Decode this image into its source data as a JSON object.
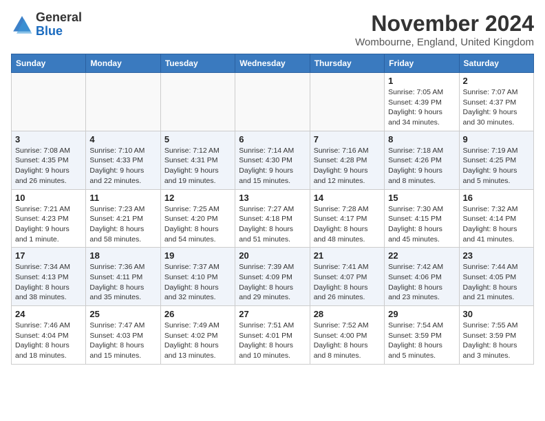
{
  "logo": {
    "general": "General",
    "blue": "Blue"
  },
  "title": "November 2024",
  "location": "Wombourne, England, United Kingdom",
  "weekdays": [
    "Sunday",
    "Monday",
    "Tuesday",
    "Wednesday",
    "Thursday",
    "Friday",
    "Saturday"
  ],
  "weeks": [
    [
      {
        "day": "",
        "info": ""
      },
      {
        "day": "",
        "info": ""
      },
      {
        "day": "",
        "info": ""
      },
      {
        "day": "",
        "info": ""
      },
      {
        "day": "",
        "info": ""
      },
      {
        "day": "1",
        "info": "Sunrise: 7:05 AM\nSunset: 4:39 PM\nDaylight: 9 hours\nand 34 minutes."
      },
      {
        "day": "2",
        "info": "Sunrise: 7:07 AM\nSunset: 4:37 PM\nDaylight: 9 hours\nand 30 minutes."
      }
    ],
    [
      {
        "day": "3",
        "info": "Sunrise: 7:08 AM\nSunset: 4:35 PM\nDaylight: 9 hours\nand 26 minutes."
      },
      {
        "day": "4",
        "info": "Sunrise: 7:10 AM\nSunset: 4:33 PM\nDaylight: 9 hours\nand 22 minutes."
      },
      {
        "day": "5",
        "info": "Sunrise: 7:12 AM\nSunset: 4:31 PM\nDaylight: 9 hours\nand 19 minutes."
      },
      {
        "day": "6",
        "info": "Sunrise: 7:14 AM\nSunset: 4:30 PM\nDaylight: 9 hours\nand 15 minutes."
      },
      {
        "day": "7",
        "info": "Sunrise: 7:16 AM\nSunset: 4:28 PM\nDaylight: 9 hours\nand 12 minutes."
      },
      {
        "day": "8",
        "info": "Sunrise: 7:18 AM\nSunset: 4:26 PM\nDaylight: 9 hours\nand 8 minutes."
      },
      {
        "day": "9",
        "info": "Sunrise: 7:19 AM\nSunset: 4:25 PM\nDaylight: 9 hours\nand 5 minutes."
      }
    ],
    [
      {
        "day": "10",
        "info": "Sunrise: 7:21 AM\nSunset: 4:23 PM\nDaylight: 9 hours\nand 1 minute."
      },
      {
        "day": "11",
        "info": "Sunrise: 7:23 AM\nSunset: 4:21 PM\nDaylight: 8 hours\nand 58 minutes."
      },
      {
        "day": "12",
        "info": "Sunrise: 7:25 AM\nSunset: 4:20 PM\nDaylight: 8 hours\nand 54 minutes."
      },
      {
        "day": "13",
        "info": "Sunrise: 7:27 AM\nSunset: 4:18 PM\nDaylight: 8 hours\nand 51 minutes."
      },
      {
        "day": "14",
        "info": "Sunrise: 7:28 AM\nSunset: 4:17 PM\nDaylight: 8 hours\nand 48 minutes."
      },
      {
        "day": "15",
        "info": "Sunrise: 7:30 AM\nSunset: 4:15 PM\nDaylight: 8 hours\nand 45 minutes."
      },
      {
        "day": "16",
        "info": "Sunrise: 7:32 AM\nSunset: 4:14 PM\nDaylight: 8 hours\nand 41 minutes."
      }
    ],
    [
      {
        "day": "17",
        "info": "Sunrise: 7:34 AM\nSunset: 4:13 PM\nDaylight: 8 hours\nand 38 minutes."
      },
      {
        "day": "18",
        "info": "Sunrise: 7:36 AM\nSunset: 4:11 PM\nDaylight: 8 hours\nand 35 minutes."
      },
      {
        "day": "19",
        "info": "Sunrise: 7:37 AM\nSunset: 4:10 PM\nDaylight: 8 hours\nand 32 minutes."
      },
      {
        "day": "20",
        "info": "Sunrise: 7:39 AM\nSunset: 4:09 PM\nDaylight: 8 hours\nand 29 minutes."
      },
      {
        "day": "21",
        "info": "Sunrise: 7:41 AM\nSunset: 4:07 PM\nDaylight: 8 hours\nand 26 minutes."
      },
      {
        "day": "22",
        "info": "Sunrise: 7:42 AM\nSunset: 4:06 PM\nDaylight: 8 hours\nand 23 minutes."
      },
      {
        "day": "23",
        "info": "Sunrise: 7:44 AM\nSunset: 4:05 PM\nDaylight: 8 hours\nand 21 minutes."
      }
    ],
    [
      {
        "day": "24",
        "info": "Sunrise: 7:46 AM\nSunset: 4:04 PM\nDaylight: 8 hours\nand 18 minutes."
      },
      {
        "day": "25",
        "info": "Sunrise: 7:47 AM\nSunset: 4:03 PM\nDaylight: 8 hours\nand 15 minutes."
      },
      {
        "day": "26",
        "info": "Sunrise: 7:49 AM\nSunset: 4:02 PM\nDaylight: 8 hours\nand 13 minutes."
      },
      {
        "day": "27",
        "info": "Sunrise: 7:51 AM\nSunset: 4:01 PM\nDaylight: 8 hours\nand 10 minutes."
      },
      {
        "day": "28",
        "info": "Sunrise: 7:52 AM\nSunset: 4:00 PM\nDaylight: 8 hours\nand 8 minutes."
      },
      {
        "day": "29",
        "info": "Sunrise: 7:54 AM\nSunset: 3:59 PM\nDaylight: 8 hours\nand 5 minutes."
      },
      {
        "day": "30",
        "info": "Sunrise: 7:55 AM\nSunset: 3:59 PM\nDaylight: 8 hours\nand 3 minutes."
      }
    ]
  ]
}
